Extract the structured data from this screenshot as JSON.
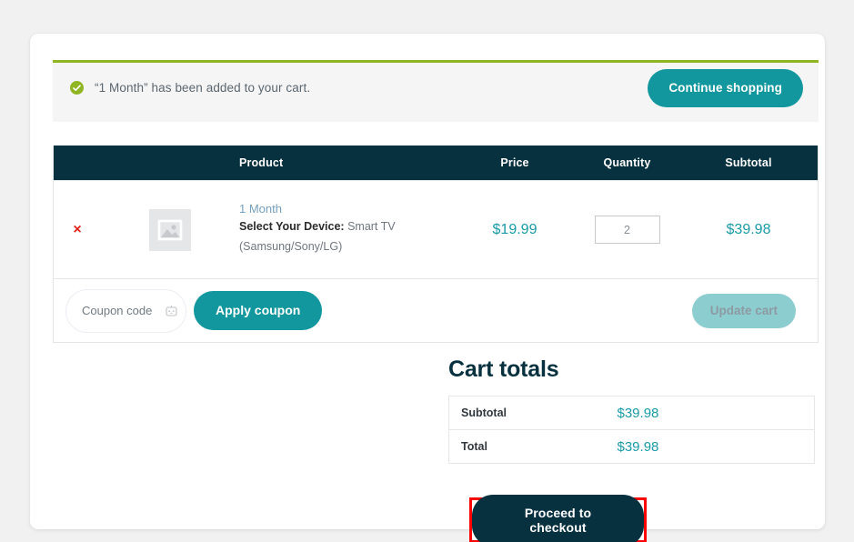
{
  "notice": {
    "icon": "check-circle-icon",
    "message": "“1 Month” has been added to your cart.",
    "continue_label": "Continue shopping",
    "accent_color": "#8fb522"
  },
  "cart_table": {
    "headers": {
      "remove": "",
      "thumbnail": "",
      "product": "Product",
      "price": "Price",
      "quantity": "Quantity",
      "subtotal": "Subtotal"
    },
    "header_bg": "#08313f",
    "rows": [
      {
        "remove_label": "×",
        "thumbnail_icon": "image-placeholder-icon",
        "product_name": "1 Month",
        "meta_label": "Select Your Device:",
        "meta_value": "Smart TV (Samsung/Sony/LG)",
        "price": "$19.99",
        "quantity": "2",
        "subtotal": "$39.98"
      }
    ]
  },
  "coupon": {
    "placeholder": "Coupon code",
    "value": "",
    "field_icon": "password-manager-icon",
    "apply_label": "Apply coupon",
    "update_label": "Update cart"
  },
  "totals": {
    "title": "Cart totals",
    "rows": [
      {
        "label": "Subtotal",
        "value": "$39.98"
      },
      {
        "label": "Total",
        "value": "$39.98"
      }
    ],
    "checkout_label": "Proceed to checkout",
    "value_color": "#1a9aa6",
    "highlight_color": "#fd0000"
  }
}
